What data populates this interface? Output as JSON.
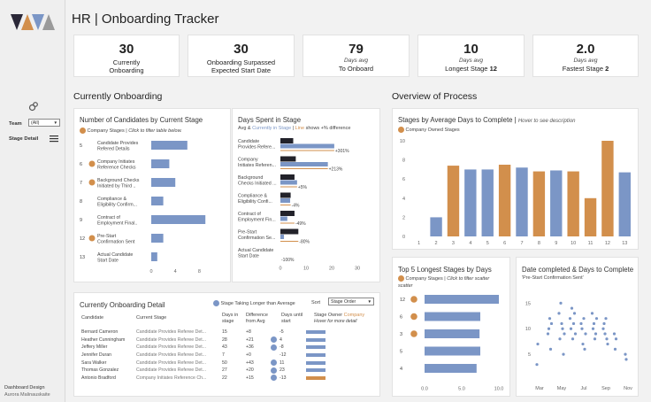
{
  "app": {
    "title": "HR | Onboarding Tracker",
    "credit_title": "Dashboard Design",
    "credit_author": "Aurora Malinauskaite"
  },
  "colors": {
    "blue": "#7b96c6",
    "orange": "#d28f4c",
    "dark": "#22222a"
  },
  "sidebar": {
    "team_label": "Team",
    "team_value": "(All)",
    "stage_detail_label": "Stage Detail"
  },
  "kpis": [
    {
      "value": "30",
      "small": "",
      "line1": "Currently",
      "line2": "Onboarding",
      "bold_suffix": ""
    },
    {
      "value": "30",
      "small": "",
      "line1": "Onboarding Surpassed",
      "line2": "Expected Start Date",
      "bold_suffix": ""
    },
    {
      "value": "79",
      "small": "Days avg",
      "line1": "To Onboard",
      "line2": "",
      "bold_suffix": ""
    },
    {
      "value": "10",
      "small": "Days avg",
      "line1": "Longest Stage",
      "line2": "",
      "bold_suffix": "12"
    },
    {
      "value": "2.0",
      "small": "Days avg",
      "line1": "Fastest Stage",
      "line2": "",
      "bold_suffix": "2"
    }
  ],
  "sections": {
    "currently_onboarding": "Currently Onboarding",
    "overview": "Overview of Process"
  },
  "candidates_by_stage": {
    "title": "Number of Candidates by Current Stage",
    "legend_label": "Company Stages",
    "legend_hint": "Click to filter table below.",
    "xticks": [
      "0",
      "4",
      "8"
    ],
    "rows": [
      {
        "stage": "5",
        "label1": "Candidate Provides",
        "label2": "Refered Details",
        "value": 6,
        "company": false
      },
      {
        "stage": "6",
        "label1": "Company Initiates",
        "label2": "Reference Checks",
        "value": 3,
        "company": true
      },
      {
        "stage": "7",
        "label1": "Background Checks",
        "label2": "Initiated by Third ..",
        "value": 4,
        "company": true
      },
      {
        "stage": "8",
        "label1": "Compliance &",
        "label2": "Eligibility Confirm...",
        "value": 2,
        "company": false
      },
      {
        "stage": "9",
        "label1": "Contract of",
        "label2": "Employment Final..",
        "value": 9,
        "company": false
      },
      {
        "stage": "12",
        "label1": "Pre-Start",
        "label2": "Confirmation Sent",
        "value": 2,
        "company": true
      },
      {
        "stage": "13",
        "label1": "Actual Candidate",
        "label2": "Start Date",
        "value": 1,
        "company": false
      }
    ]
  },
  "days_in_stage": {
    "title": "Days Spent in Stage",
    "sub_prefix": "Avg &",
    "sub_current": "Currently in Stage",
    "sub_line": "Line",
    "sub_suffix": "shows +% difference",
    "xticks": [
      "0",
      "10",
      "20",
      "30"
    ],
    "rows": [
      {
        "label1": "Candidate",
        "label2": "Provides Refere...",
        "avg": 5,
        "current": 21,
        "pct": "+301%"
      },
      {
        "label1": "Company",
        "label2": "Initiates Referen...",
        "avg": 6,
        "current": 18.5,
        "pct": "+213%"
      },
      {
        "label1": "Background",
        "label2": "Checks Initiated ...",
        "avg": 5.5,
        "current": 6.5,
        "pct": "+5%"
      },
      {
        "label1": "Compliance &",
        "label2": "Eligibility Confi...",
        "avg": 4,
        "current": 3.8,
        "pct": "-4%"
      },
      {
        "label1": "Contract of",
        "label2": "Employment Fin...",
        "avg": 5.5,
        "current": 2.7,
        "pct": "-49%"
      },
      {
        "label1": "Pre-Start",
        "label2": "Confirmation Se...",
        "avg": 7,
        "current": 1.4,
        "pct": "-80%"
      },
      {
        "label1": "Actual Candidate",
        "label2": "Start Date",
        "avg": 0,
        "current": 0,
        "pct": "-100%"
      }
    ]
  },
  "detail": {
    "title": "Currently Onboarding Detail",
    "legend": "Stage Taking Longer than Average",
    "sort_label": "Sort",
    "sort_value": "Stage Order",
    "headers": {
      "candidate": "Candidate",
      "stage": "Current Stage",
      "days": "Days in stage",
      "diff": "Difference from Avg",
      "until": "Days until start",
      "owner": "Stage Owner",
      "owner_company": "Company",
      "owner_hint": "Hover for more detail"
    },
    "rows": [
      {
        "name": "Bernard Cameron",
        "stage": "Candidate Provides Referee Det...",
        "days": "15",
        "diff": "+8",
        "dot": false,
        "until": "-5",
        "company": false
      },
      {
        "name": "Heather Cunningham",
        "stage": "Candidate Provides Referee Det...",
        "days": "28",
        "diff": "+21",
        "dot": true,
        "until": "4",
        "company": false
      },
      {
        "name": "Jeffery Miller",
        "stage": "Candidate Provides Referee Det...",
        "days": "43",
        "diff": "+36",
        "dot": true,
        "until": "-8",
        "company": false
      },
      {
        "name": "Jennifer Duran",
        "stage": "Candidate Provides Referee Det...",
        "days": "7",
        "diff": "+0",
        "dot": false,
        "until": "-12",
        "company": false
      },
      {
        "name": "Sara Walker",
        "stage": "Candidate Provides Referee Det...",
        "days": "50",
        "diff": "+43",
        "dot": true,
        "until": "11",
        "company": false
      },
      {
        "name": "Thomas Gonzalez",
        "stage": "Candidate Provides Referee Det...",
        "days": "27",
        "diff": "+20",
        "dot": true,
        "until": "23",
        "company": false
      },
      {
        "name": "Antonio Bradford",
        "stage": "Company Initiates Reference Ch...",
        "days": "22",
        "diff": "+15",
        "dot": true,
        "until": "-13",
        "company": true
      }
    ]
  },
  "chart_data": [
    {
      "type": "bar",
      "title": "Stages by Average Days to Complete",
      "title_hint": "Hover to see description",
      "legend": "Company Owned Stages",
      "categories": [
        "1",
        "2",
        "3",
        "4",
        "5",
        "6",
        "7",
        "8",
        "9",
        "10",
        "11",
        "12",
        "13"
      ],
      "values": [
        0,
        2,
        7.4,
        7,
        7,
        7.5,
        7.2,
        6.8,
        6.9,
        6.8,
        4,
        10,
        6.7
      ],
      "company": [
        false,
        false,
        true,
        false,
        false,
        true,
        false,
        true,
        false,
        true,
        true,
        true,
        false
      ],
      "ylim": [
        0,
        10
      ],
      "yticks": [
        "0",
        "2",
        "4",
        "6",
        "8",
        "10"
      ]
    },
    {
      "type": "bar",
      "title": "Top 5 Longest Stages by Days",
      "legend": "Company Stages",
      "legend_hint": "Click to filter scatter",
      "categories": [
        "12",
        "6",
        "3",
        "5",
        "4"
      ],
      "values": [
        10,
        7.5,
        7.4,
        7.5,
        7.0
      ],
      "company": [
        true,
        true,
        true,
        false,
        false
      ],
      "xlim": [
        0,
        10
      ],
      "xticks": [
        "0.0",
        "5.0",
        "10.0"
      ]
    },
    {
      "type": "scatter",
      "title": "Date completed & Days to Complete",
      "subtitle": "'Pre-Start Confirmation Sent'",
      "xticks": [
        "Mar",
        "May",
        "Jul",
        "Sep",
        "Nov"
      ],
      "yticks": [
        "5",
        "10",
        "15"
      ],
      "ylim": [
        0,
        18
      ],
      "points": [
        [
          "Mar",
          3
        ],
        [
          "Mar",
          7
        ],
        [
          "Apr",
          9
        ],
        [
          "Apr",
          10
        ],
        [
          "Apr",
          12
        ],
        [
          "Apr",
          6
        ],
        [
          "Apr",
          11
        ],
        [
          "May",
          13
        ],
        [
          "May",
          8
        ],
        [
          "May",
          15
        ],
        [
          "May",
          11
        ],
        [
          "May",
          10
        ],
        [
          "May",
          5
        ],
        [
          "May",
          9
        ],
        [
          "Jun",
          12
        ],
        [
          "Jun",
          10
        ],
        [
          "Jun",
          14
        ],
        [
          "Jun",
          8
        ],
        [
          "Jun",
          11
        ],
        [
          "Jun",
          13
        ],
        [
          "Jun",
          9
        ],
        [
          "Jul",
          11
        ],
        [
          "Jul",
          10
        ],
        [
          "Jul",
          7
        ],
        [
          "Jul",
          12
        ],
        [
          "Jul",
          6
        ],
        [
          "Jul",
          9
        ],
        [
          "Aug",
          13
        ],
        [
          "Aug",
          10
        ],
        [
          "Aug",
          11
        ],
        [
          "Aug",
          8
        ],
        [
          "Aug",
          9
        ],
        [
          "Aug",
          12
        ],
        [
          "Sep",
          10
        ],
        [
          "Sep",
          11
        ],
        [
          "Sep",
          9
        ],
        [
          "Sep",
          12
        ],
        [
          "Sep",
          8
        ],
        [
          "Sep",
          7
        ],
        [
          "Oct",
          9
        ],
        [
          "Oct",
          6
        ],
        [
          "Oct",
          8
        ],
        [
          "Nov",
          5
        ],
        [
          "Nov",
          4
        ]
      ]
    }
  ]
}
